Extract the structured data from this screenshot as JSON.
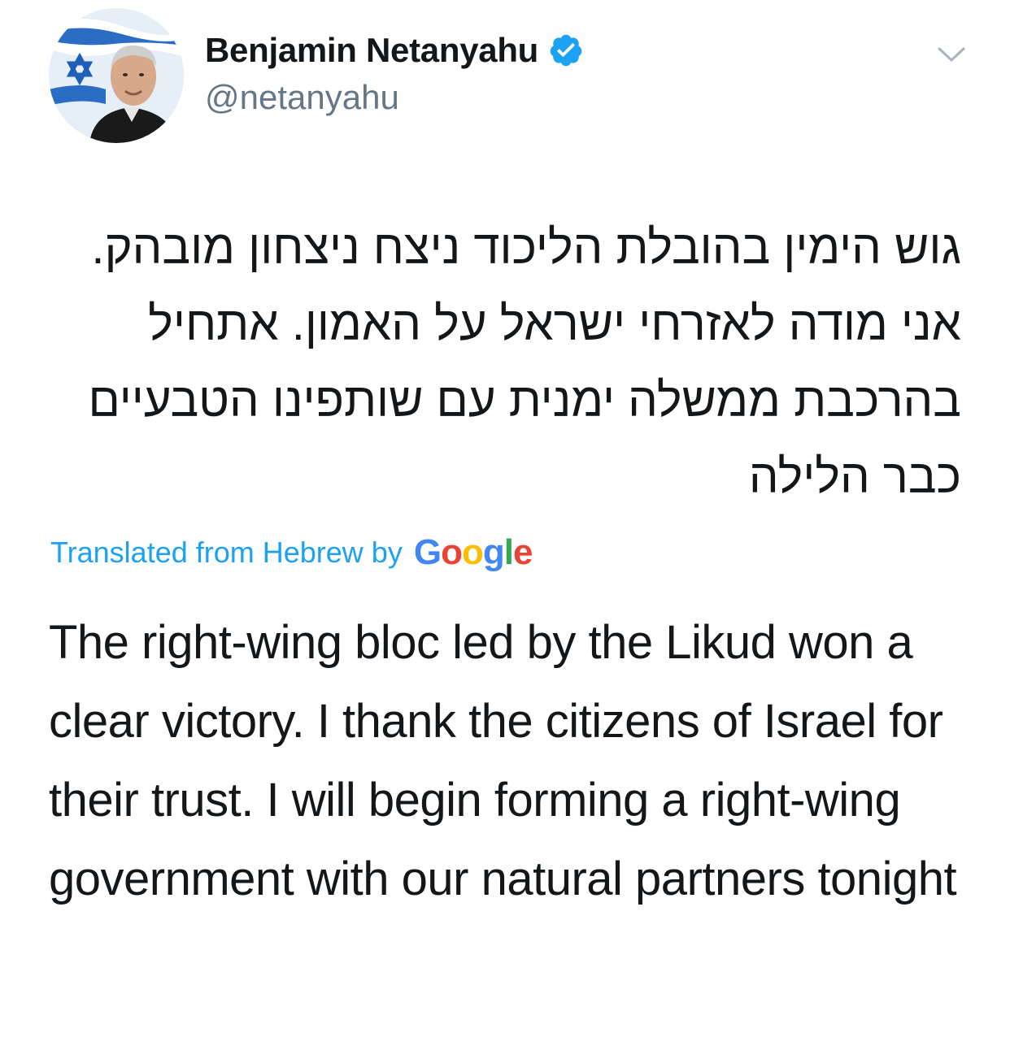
{
  "tweet": {
    "author": {
      "display_name": "Benjamin Netanyahu",
      "handle": "@netanyahu",
      "verified": true,
      "verified_icon": "verified-badge-icon"
    },
    "menu_icon": "chevron-down-icon",
    "original_text": "גוש הימין בהובלת הליכוד ניצח ניצחון מובהק. אני מודה לאזרחי ישראל על האמון. אתחיל בהרכבת ממשלה ימנית עם שותפינו הטבעיים כבר הלילה",
    "translation_label": "Translated from Hebrew by",
    "translation_provider": "Google",
    "translated_text": "The right-wing bloc led by the Likud won a clear victory. I thank the citizens of Israel for their trust. I will begin forming a right-wing government with our natural partners tonight"
  },
  "colors": {
    "text": "#14171a",
    "secondary": "#657786",
    "accent": "#1da1f2",
    "google_blue": "#4285f4",
    "google_red": "#ea4335",
    "google_yellow": "#fbbc05",
    "google_green": "#34a853"
  }
}
